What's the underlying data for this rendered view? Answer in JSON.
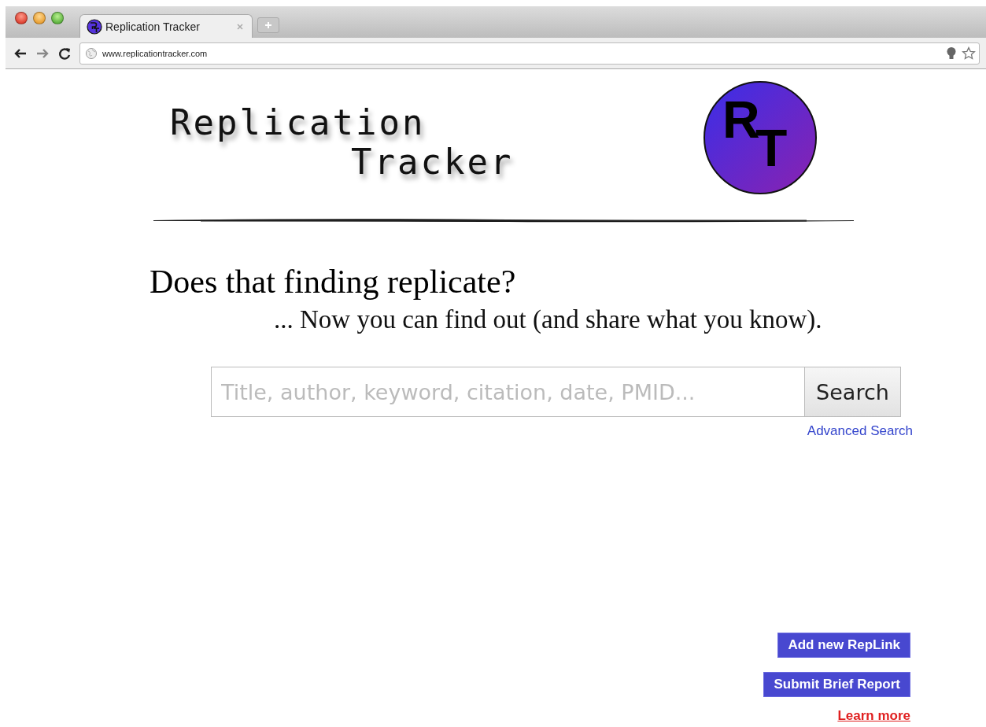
{
  "browser": {
    "tab": {
      "title": "Replication Tracker",
      "selected": true
    },
    "url": "www.replicationtracker.com"
  },
  "header": {
    "title_lines": [
      "Replication",
      "Tracker"
    ],
    "logo_letters": [
      "R",
      "T"
    ]
  },
  "headline": "Does that finding replicate?",
  "subheadline": "... Now you can find out (and share what you know).",
  "search": {
    "placeholder": "Title, author, keyword, citation, date, PMID...",
    "button": "Search",
    "advanced_link": "Advanced Search"
  },
  "actions": [
    "Add new RepLink",
    "Submit Brief Report"
  ],
  "learn_more": "Learn more"
}
